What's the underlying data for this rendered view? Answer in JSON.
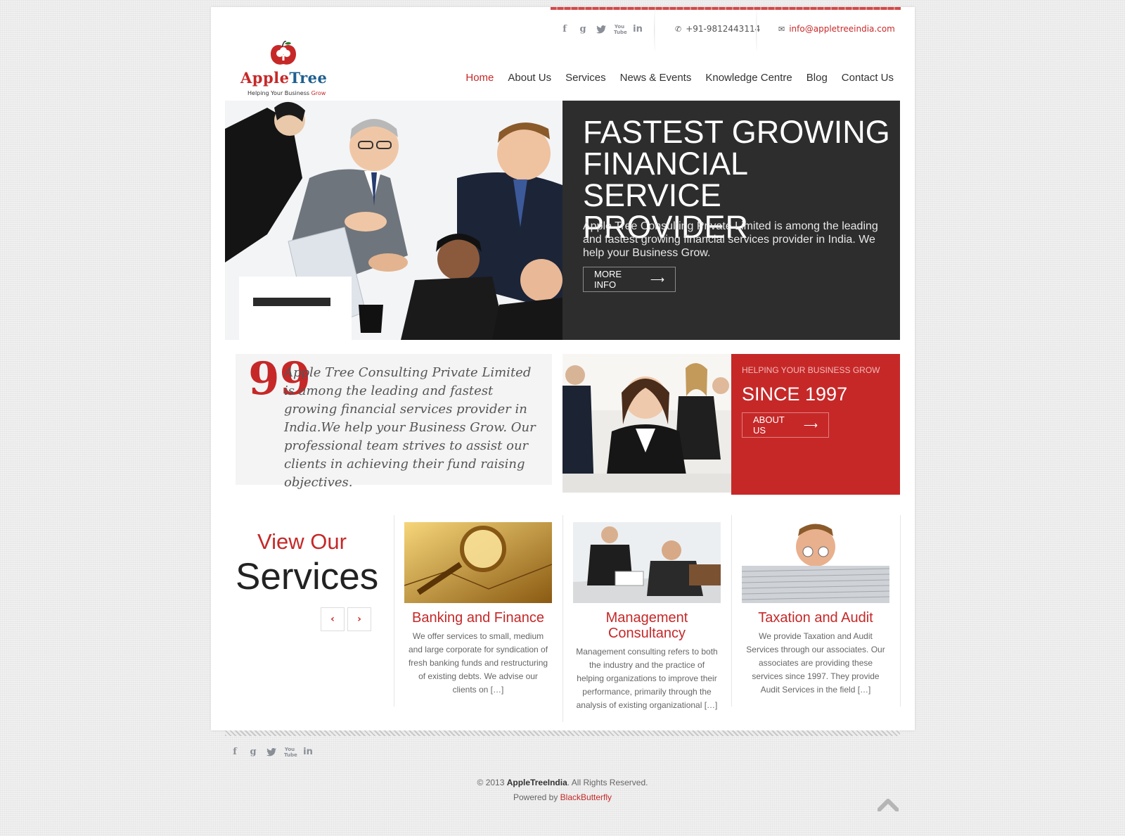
{
  "header": {
    "social": [
      "f",
      "g",
      "t",
      "You Tube",
      "in"
    ],
    "phone": "+91-9812443114",
    "email": "info@appletreeindia.com",
    "logo": {
      "brand_1": "Apple",
      "brand_2": "Tree",
      "tagline_1": "Helping Your Business ",
      "tagline_2": "Grow"
    },
    "nav": [
      "Home",
      "About Us",
      "Services",
      "News & Events",
      "Knowledge Centre",
      "Blog",
      "Contact Us"
    ],
    "active_nav": "Home"
  },
  "hero": {
    "title": "FASTEST GROWING FINANCIAL SERVICE PROVIDER",
    "text": "Apple Tree Consulting Private Limited is among the leading and fastest growing financial services provider in India. We help your Business Grow.",
    "button": "MORE INFO",
    "button_arrow": "⟶"
  },
  "quote": {
    "mark": "99",
    "text": "Apple Tree Consulting Private Limited is among the leading and fastest growing financial services provider in India.We help your Business Grow. Our professional team strives to assist our clients in achieving their fund raising objectives."
  },
  "promo": {
    "small": "HELPING YOUR BUSINESS GROW",
    "big": "SINCE 1997",
    "button": "ABOUT US",
    "button_arrow": "⟶"
  },
  "services": {
    "heading_1": "View Our",
    "heading_2": "Services",
    "prev": "‹",
    "next": "›",
    "items": [
      {
        "name": "Banking and Finance",
        "desc": "We offer services to small, medium and large corporate for syndication of fresh banking funds and restructuring of existing debts.  We advise our clients on […]"
      },
      {
        "name": "Management Consultancy",
        "desc": "Management consulting refers to both the industry and the practice of helping organizations to improve their performance, primarily through the analysis of existing organizational […]"
      },
      {
        "name": "Taxation and Audit",
        "desc": "We provide Taxation and Audit Services through our associates.  Our associates are providing these services since 1997.  They provide Audit Services in the field […]"
      }
    ]
  },
  "footer": {
    "social": [
      "f",
      "g",
      "t",
      "You Tube",
      "in"
    ],
    "copyright_prefix": "© 2013 ",
    "copyright_brand": "AppleTreeIndia",
    "copyright_suffix": ". All Rights Reserved.",
    "powered_prefix": "Powered by ",
    "powered_by": "BlackButterfly"
  },
  "colors": {
    "accent": "#c62828",
    "dark_panel": "#2e2d2d",
    "page_bg": "#ececec"
  }
}
